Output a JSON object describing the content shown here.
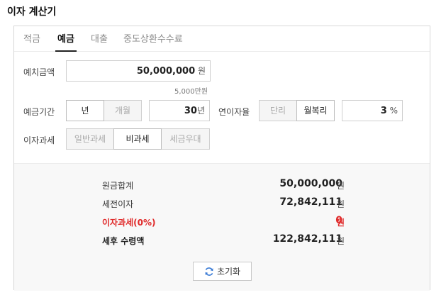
{
  "page_title": "이자 계산기",
  "tabs": [
    {
      "label": "적금",
      "active": false
    },
    {
      "label": "예금",
      "active": true
    },
    {
      "label": "대출",
      "active": false
    },
    {
      "label": "중도상환수수료",
      "active": false
    }
  ],
  "deposit": {
    "label": "예치금액",
    "value": "50,000,000",
    "unit": "원",
    "hint": "5,000만원"
  },
  "period": {
    "label": "예금기간",
    "options": [
      "년",
      "개월"
    ],
    "selected": "년",
    "value": "30",
    "unit": "년"
  },
  "rate": {
    "label": "연이자율",
    "options": [
      "단리",
      "월복리"
    ],
    "selected": "월복리",
    "value": "3",
    "unit": "%"
  },
  "tax": {
    "label": "이자과세",
    "options": [
      "일반과세",
      "비과세",
      "세금우대"
    ],
    "selected": "비과세"
  },
  "results": {
    "principal": {
      "label": "원금합계",
      "value": "50,000,000",
      "unit": "원"
    },
    "pretax_interest": {
      "label": "세전이자",
      "value": "72,842,111",
      "unit": "원"
    },
    "interest_tax": {
      "label": "이자과세(0%)",
      "value": "0",
      "unit": "원"
    },
    "after_tax": {
      "label": "세후 수령액",
      "value": "122,842,111",
      "unit": "원"
    }
  },
  "reset_label": "초기화",
  "colors": {
    "accent_red": "#e02a2a",
    "result_bg": "#f8f8f8",
    "reset_icon": "#3a7bd5"
  }
}
